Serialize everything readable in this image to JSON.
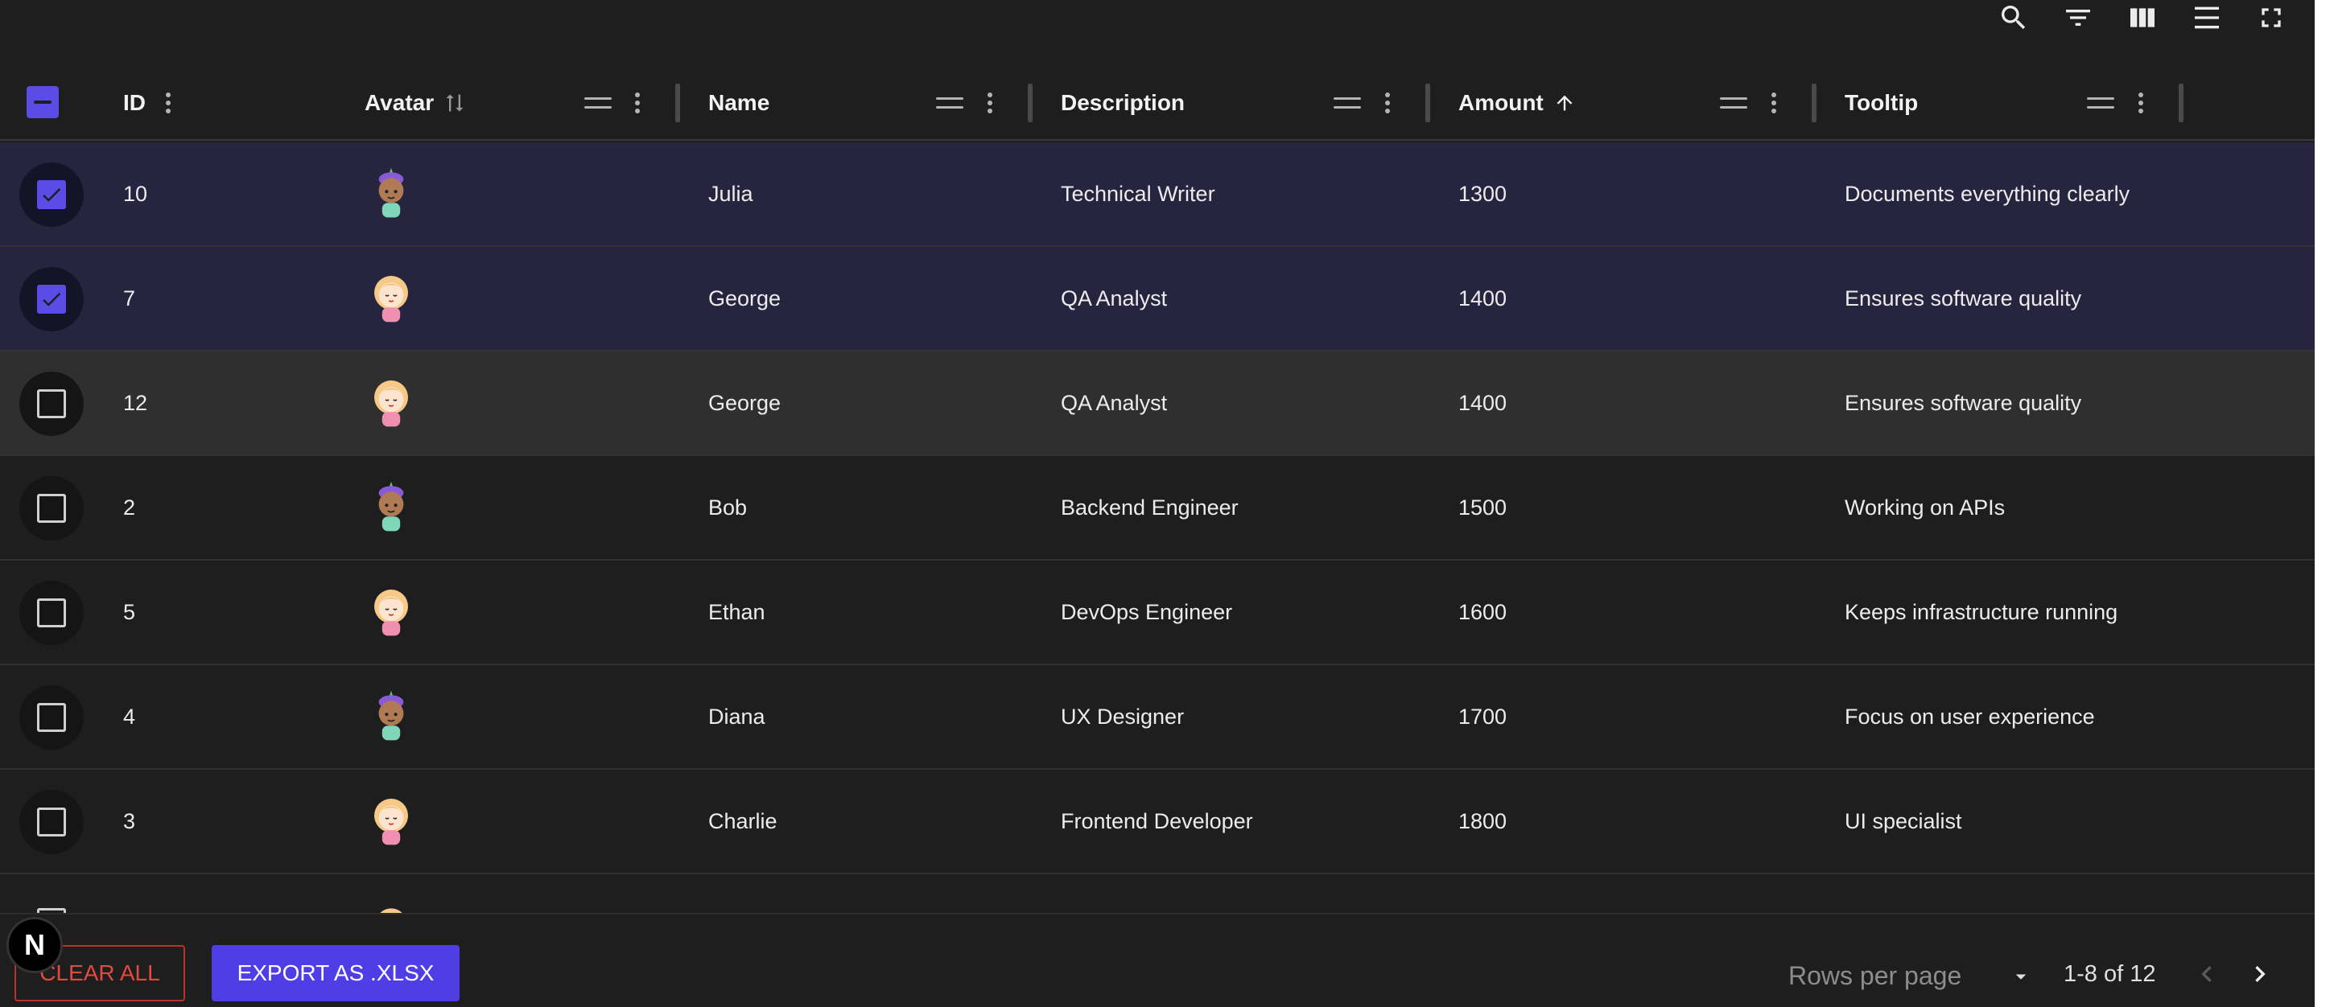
{
  "toolbar": {
    "icons": [
      "search-icon",
      "filter-icon",
      "columns-icon",
      "density-icon",
      "fullscreen-icon"
    ]
  },
  "columns": {
    "id": "ID",
    "avatar": "Avatar",
    "name": "Name",
    "description": "Description",
    "amount": "Amount",
    "tooltip": "Tooltip"
  },
  "rows": [
    {
      "id": "10",
      "avatar": "purple-avatar-icon",
      "name": "Julia",
      "description": "Technical Writer",
      "amount": "1300",
      "tooltip": "Documents everything clearly",
      "selected": true
    },
    {
      "id": "7",
      "avatar": "blonde-avatar-icon",
      "name": "George",
      "description": "QA Analyst",
      "amount": "1400",
      "tooltip": "Ensures software quality",
      "selected": true
    },
    {
      "id": "12",
      "avatar": "blonde-avatar-icon",
      "name": "George",
      "description": "QA Analyst",
      "amount": "1400",
      "tooltip": "Ensures software quality",
      "selected": false
    },
    {
      "id": "2",
      "avatar": "purple-avatar-icon",
      "name": "Bob",
      "description": "Backend Engineer",
      "amount": "1500",
      "tooltip": "Working on APIs",
      "selected": false
    },
    {
      "id": "5",
      "avatar": "blonde-avatar-icon",
      "name": "Ethan",
      "description": "DevOps Engineer",
      "amount": "1600",
      "tooltip": "Keeps infrastructure running",
      "selected": false
    },
    {
      "id": "4",
      "avatar": "purple-avatar-icon",
      "name": "Diana",
      "description": "UX Designer",
      "amount": "1700",
      "tooltip": "Focus on user experience",
      "selected": false
    },
    {
      "id": "3",
      "avatar": "blonde-avatar-icon",
      "name": "Charlie",
      "description": "Frontend Developer",
      "amount": "1800",
      "tooltip": "UI specialist",
      "selected": false
    }
  ],
  "footer": {
    "clear_label": "CLEAR ALL",
    "export_label": "EXPORT AS .XLSX",
    "rows_per_page_label": "Rows per page",
    "range_label": "1-8 of 12",
    "badge_letter": "N"
  },
  "colors": {
    "accent": "#5b4ce6",
    "selected_row": "#26243f",
    "danger": "#e04a3f"
  }
}
